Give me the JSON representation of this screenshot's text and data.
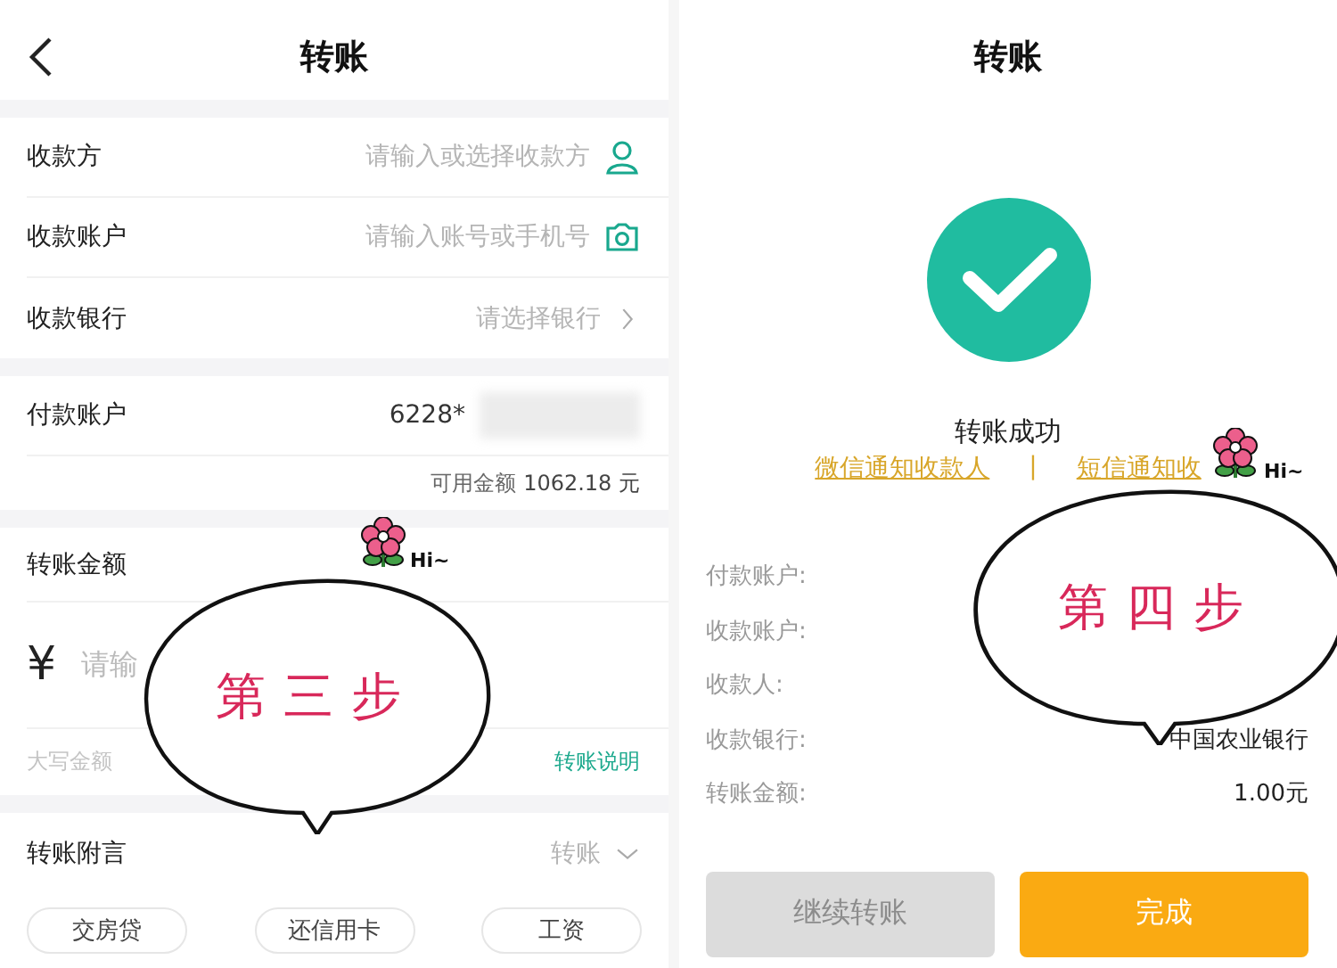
{
  "left_screen": {
    "title": "转账",
    "payee_fields": [
      {
        "label": "收款方",
        "placeholder": "请输入或选择收款方",
        "kind": "person"
      },
      {
        "label": "收款账户",
        "placeholder": "请输入账号或手机号",
        "kind": "camera"
      },
      {
        "label": "收款银行",
        "placeholder": "请选择银行",
        "kind": "chevron"
      }
    ],
    "payer_account": {
      "label": "付款账户",
      "value": "6228*",
      "balance_label": "可用金额",
      "balance": "1062.18 元"
    },
    "amount": {
      "label": "转账金额",
      "currency": "¥",
      "placeholder": "请输",
      "uppercase_label": "大写金额",
      "help_link": "转账说明"
    },
    "note": {
      "label": "转账附言",
      "value": "转账"
    },
    "quick_notes": [
      "交房贷",
      "还信用卡",
      "工资"
    ],
    "sticker": {
      "text": "第三步",
      "greeting": "Hi~"
    }
  },
  "right_screen": {
    "title": "转账",
    "status": "转账成功",
    "notify_links": [
      "微信通知收款人",
      "短信通知收"
    ],
    "separator": "|",
    "details": [
      {
        "label": "付款账户:"
      },
      {
        "label": "收款账户:"
      },
      {
        "label": "收款人:"
      },
      {
        "label": "收款银行:",
        "value": "中国农业银行"
      },
      {
        "label": "转账金额:",
        "value": "1.00元"
      }
    ],
    "buttons": [
      {
        "label": "继续转账",
        "disabled": true
      },
      {
        "label": "完成",
        "disabled": false
      }
    ],
    "sticker": {
      "text": "第四步",
      "greeting": "Hi~"
    }
  }
}
